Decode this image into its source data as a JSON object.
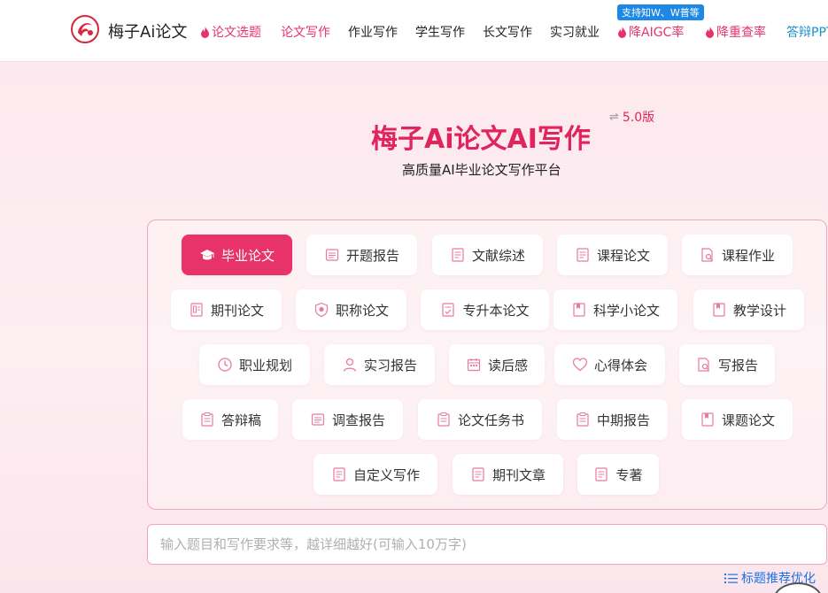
{
  "header": {
    "brand": "梅子Ai论文",
    "nav": [
      {
        "label": "论文选题",
        "hot": true
      },
      {
        "label": "论文写作",
        "hot": false,
        "accent": true
      },
      {
        "label": "作业写作",
        "hot": false
      },
      {
        "label": "学生写作",
        "hot": false
      },
      {
        "label": "长文写作",
        "hot": false
      },
      {
        "label": "实习就业",
        "hot": false
      },
      {
        "label": "降AIGC率",
        "hot": true
      },
      {
        "label": "降重查率",
        "hot": true
      },
      {
        "label": "答辩PPT",
        "hot": false
      }
    ],
    "badge": "支持知W、W普等"
  },
  "hero": {
    "title": "梅子Ai论文AI写作",
    "version_icon": "⇌",
    "version": "5.0版",
    "subtitle": "高质量AI毕业论文写作平台"
  },
  "categories": [
    {
      "label": "毕业论文",
      "icon": "graduation-cap-icon",
      "active": true
    },
    {
      "label": "开题报告",
      "icon": "document-icon"
    },
    {
      "label": "文献综述",
      "icon": "document-icon"
    },
    {
      "label": "课程论文",
      "icon": "document-icon"
    },
    {
      "label": "课程作业",
      "icon": "document-search-icon"
    },
    {
      "label": "期刊论文",
      "icon": "journal-icon"
    },
    {
      "label": "职称论文",
      "icon": "shield-icon"
    },
    {
      "label": "专升本论文",
      "icon": "document-check-icon"
    },
    {
      "label": "科学小论文",
      "icon": "book-icon"
    },
    {
      "label": "教学设计",
      "icon": "book-icon"
    },
    {
      "label": "职业规划",
      "icon": "clock-icon"
    },
    {
      "label": "实习报告",
      "icon": "person-icon"
    },
    {
      "label": "读后感",
      "icon": "calendar-icon"
    },
    {
      "label": "心得体会",
      "icon": "heart-icon"
    },
    {
      "label": "写报告",
      "icon": "document-search-icon"
    },
    {
      "label": "答辩稿",
      "icon": "clipboard-icon"
    },
    {
      "label": "调查报告",
      "icon": "document-icon"
    },
    {
      "label": "论文任务书",
      "icon": "clipboard-icon"
    },
    {
      "label": "中期报告",
      "icon": "clipboard-icon"
    },
    {
      "label": "课题论文",
      "icon": "book-icon"
    },
    {
      "label": "自定义写作",
      "icon": "document-icon"
    },
    {
      "label": "期刊文章",
      "icon": "document-icon"
    },
    {
      "label": "专著",
      "icon": "document-icon"
    }
  ],
  "input": {
    "placeholder": "输入题目和写作要求等，越详细越好(可输入10万字)",
    "value": ""
  },
  "recommend": {
    "icon": "list-icon",
    "label": "标题推荐优化"
  },
  "colors": {
    "accent": "#e8336a",
    "link": "#1a73e8",
    "badge": "#1e88e5"
  }
}
